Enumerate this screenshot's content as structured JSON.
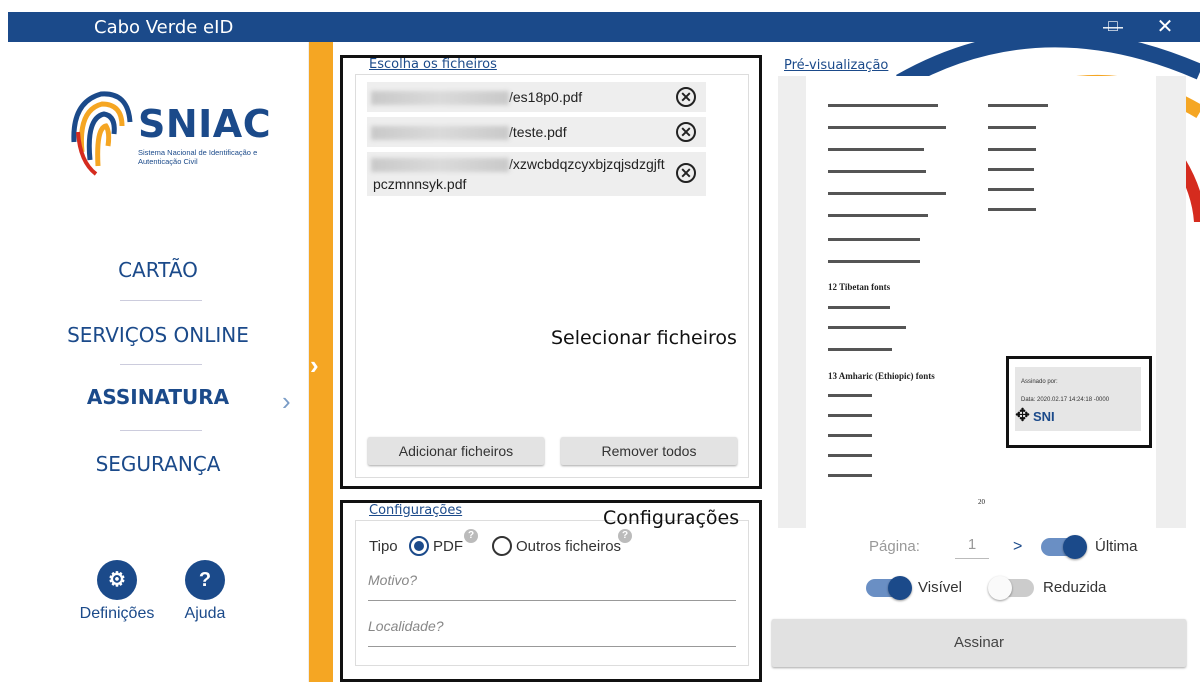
{
  "window": {
    "title": "Cabo Verde eID",
    "minimize": "—",
    "maximize": "□",
    "close": "✕"
  },
  "sidebar": {
    "logo_text": "SNIAC",
    "logo_sub": "Sistema Nacional de Identificação e Autenticação Civil",
    "items": [
      {
        "label": "CARTÃO"
      },
      {
        "label": "SERVIÇOS ONLINE"
      },
      {
        "label": "ASSINATURA"
      },
      {
        "label": "SEGURANÇA"
      }
    ],
    "settings_label": "Definições",
    "help_label": "Ajuda"
  },
  "files": {
    "title": "Escolha os ficheiros",
    "items": [
      {
        "name": "/es18p0.pdf"
      },
      {
        "name": "/teste.pdf"
      },
      {
        "name_line1": "/xzwcbdqzcyxbjzqjsdzgjft",
        "name_line2": "pczmnnsyk.pdf"
      }
    ],
    "add_label": "Adicionar ficheiros",
    "remove_all_label": "Remover todos",
    "overlay_label": "Selecionar ficheiros"
  },
  "config": {
    "title": "Configurações",
    "overlay_label": "Configurações",
    "type_label": "Tipo",
    "opt_pdf": "PDF",
    "opt_other": "Outros ficheiros",
    "reason_placeholder": "Motivo?",
    "location_placeholder": "Localidade?"
  },
  "preview": {
    "title": "Pré-visualização",
    "page_label": "Página:",
    "page_value": "1",
    "next": ">",
    "last_label": "Última",
    "visible_label": "Visível",
    "reduced_label": "Reduzida",
    "sign_label": "Assinar",
    "sig_signed_by": "Assinado por:",
    "sig_date": "Data: 2020.02.17 14:24:18 -0000",
    "sig_logo": "SNI",
    "doc_section_12": "12   Tibetan fonts",
    "doc_section_13": "13   Amharic (Ethiopic) fonts",
    "doc_page_number": "20"
  },
  "colors": {
    "brand": "#1b4a8a",
    "accent": "#f5a623"
  }
}
